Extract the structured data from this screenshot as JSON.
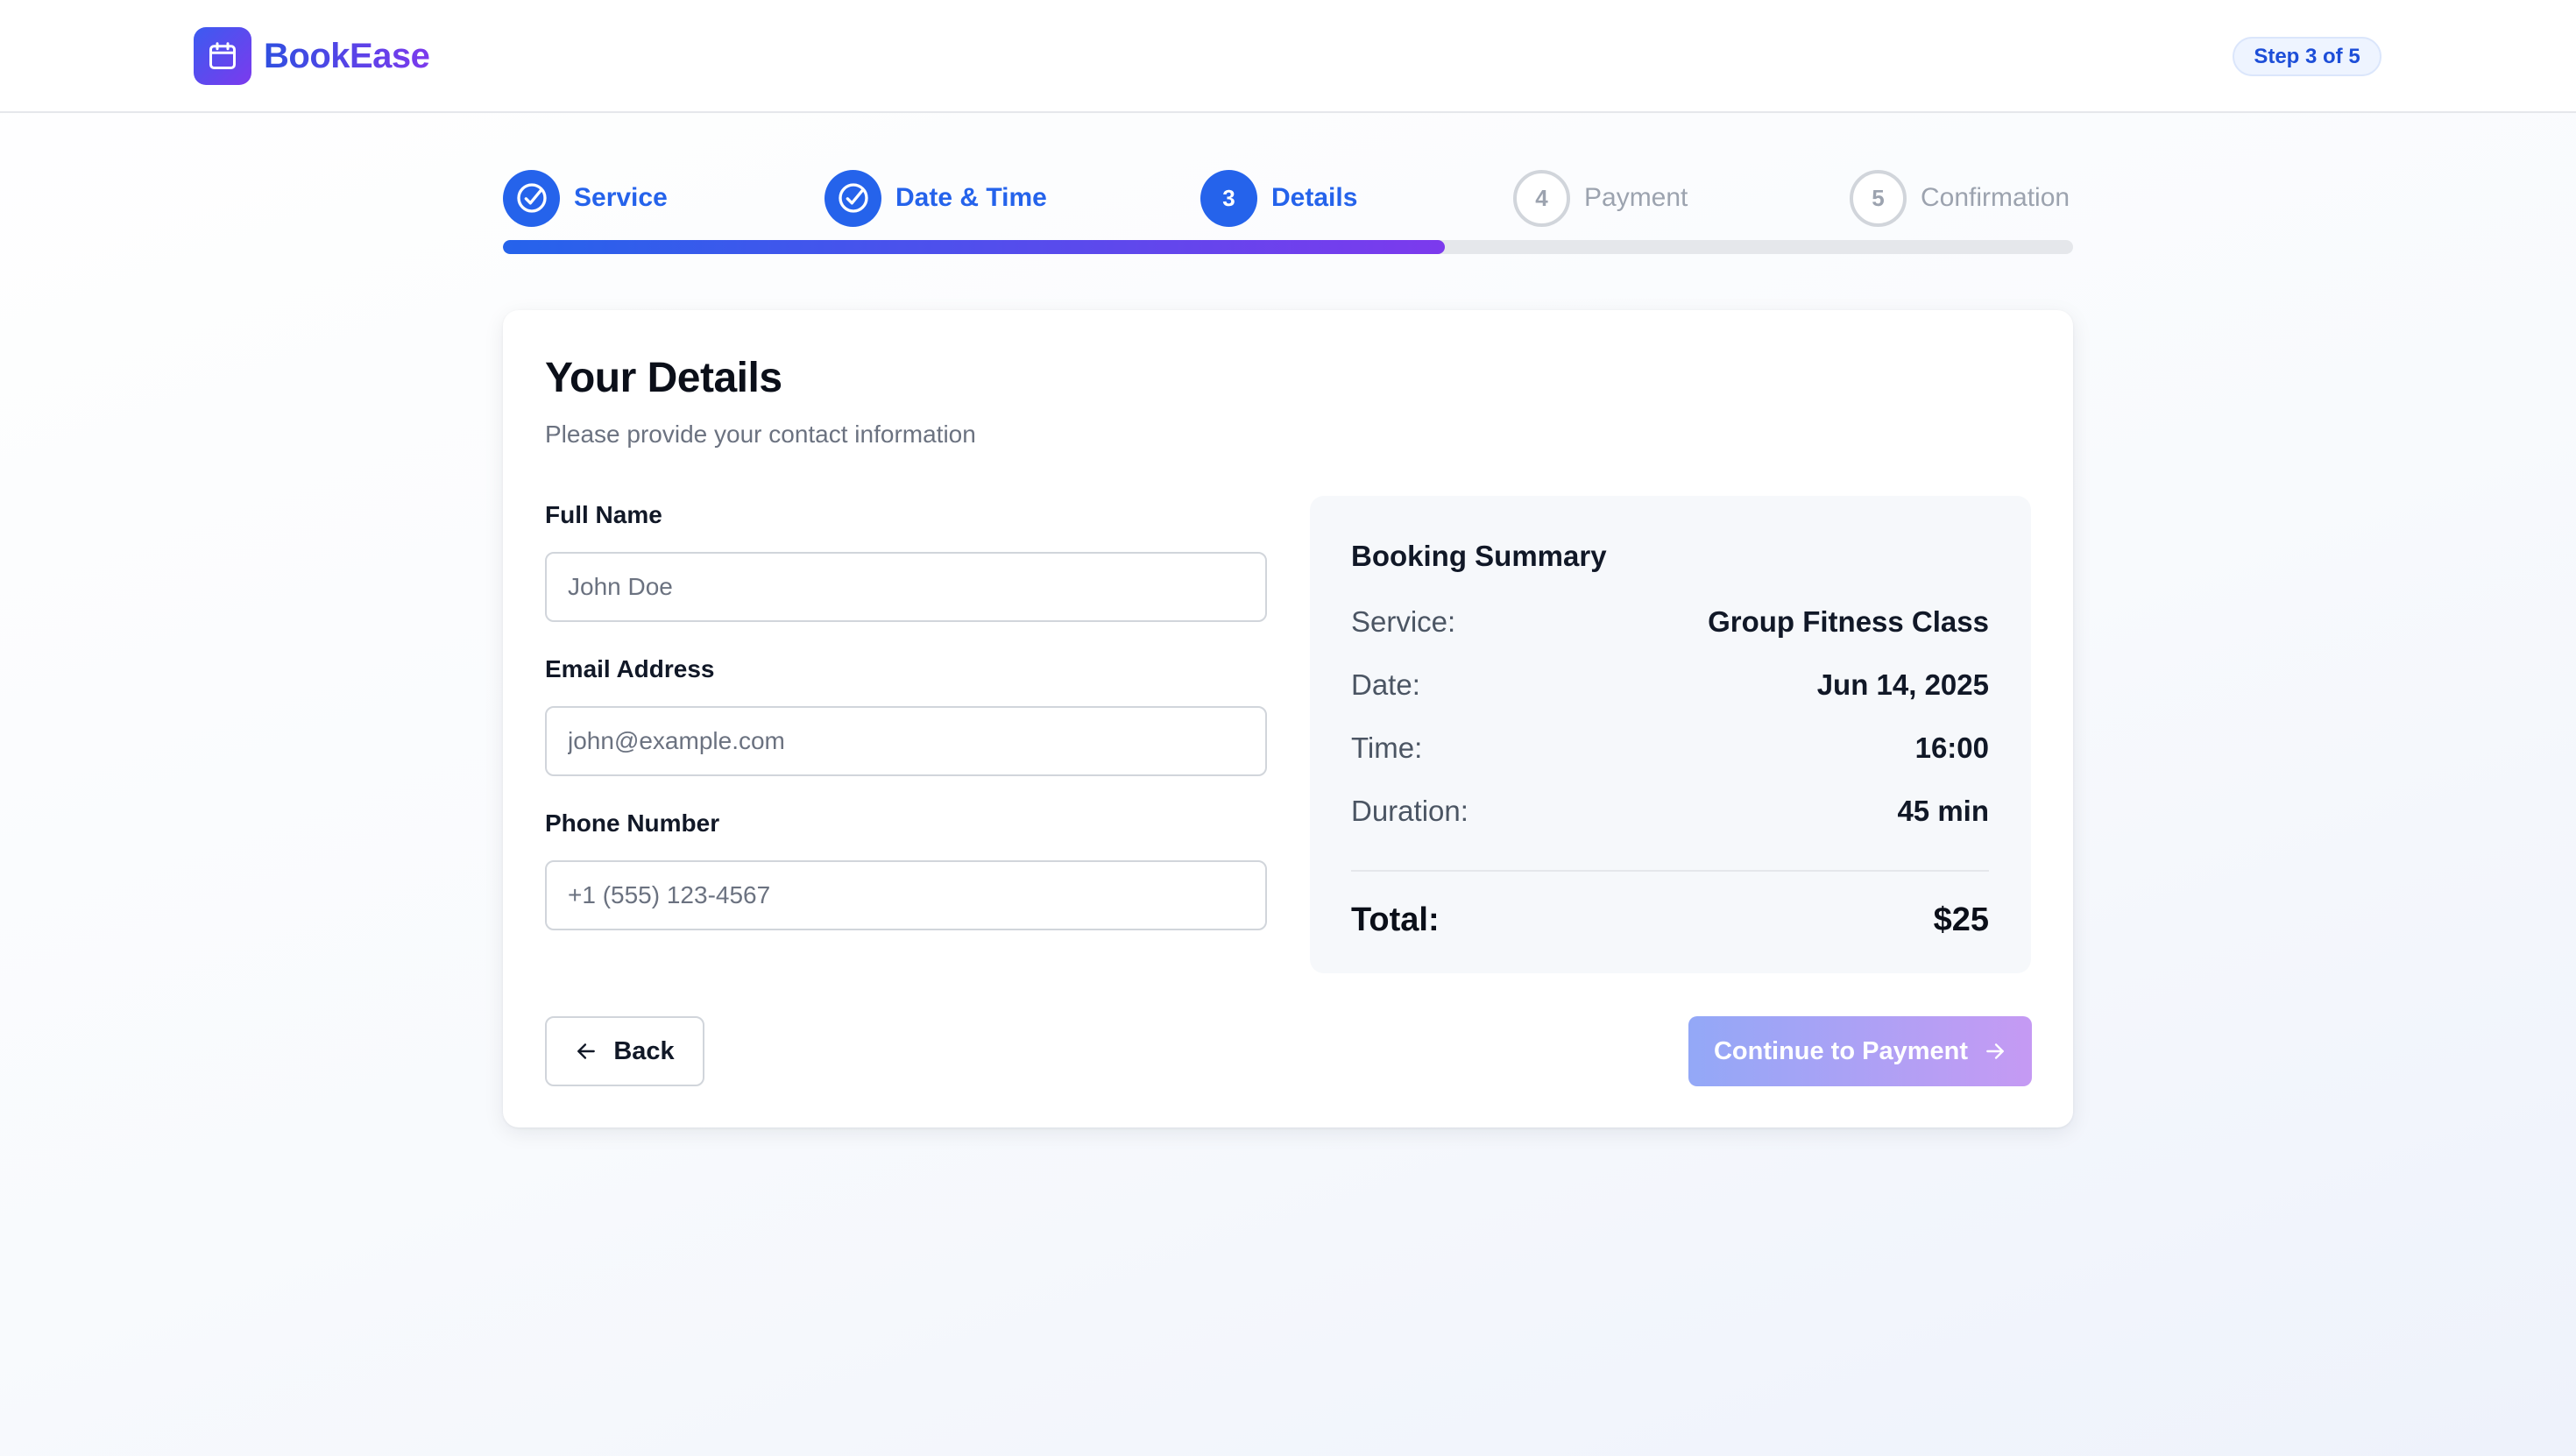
{
  "app": {
    "name": "BookEase",
    "logo_icon": "calendar-icon",
    "step_indicator": "Step 3 of 5"
  },
  "stepper": {
    "progress_percent": 60,
    "steps": [
      {
        "number": "1",
        "label": "Service",
        "state": "done",
        "icon": "check-circle-icon"
      },
      {
        "number": "2",
        "label": "Date & Time",
        "state": "done",
        "icon": "check-circle-icon"
      },
      {
        "number": "3",
        "label": "Details",
        "state": "current"
      },
      {
        "number": "4",
        "label": "Payment",
        "state": "todo"
      },
      {
        "number": "5",
        "label": "Confirmation",
        "state": "todo"
      }
    ]
  },
  "form": {
    "title": "Your Details",
    "subtitle": "Please provide your contact information",
    "fields": [
      {
        "label": "Full Name",
        "placeholder": "John Doe",
        "value": ""
      },
      {
        "label": "Email Address",
        "placeholder": "john@example.com",
        "value": ""
      },
      {
        "label": "Phone Number",
        "placeholder": "+1 (555) 123-4567",
        "value": ""
      }
    ]
  },
  "summary": {
    "title": "Booking Summary",
    "rows": [
      {
        "key": "Service:",
        "value": "Group Fitness Class"
      },
      {
        "key": "Date:",
        "value": "Jun 14, 2025"
      },
      {
        "key": "Time:",
        "value": "16:00"
      },
      {
        "key": "Duration:",
        "value": "45 min"
      }
    ],
    "total_label": "Total:",
    "total_value": "$25"
  },
  "actions": {
    "back_label": "Back",
    "back_icon": "arrow-left-icon",
    "continue_label": "Continue to Payment",
    "continue_icon": "arrow-right-icon"
  },
  "colors": {
    "primary": "#2563eb",
    "accent": "#7c3aed",
    "continue_disabled_start": "#93a8f7",
    "continue_disabled_end": "#c59af3"
  }
}
